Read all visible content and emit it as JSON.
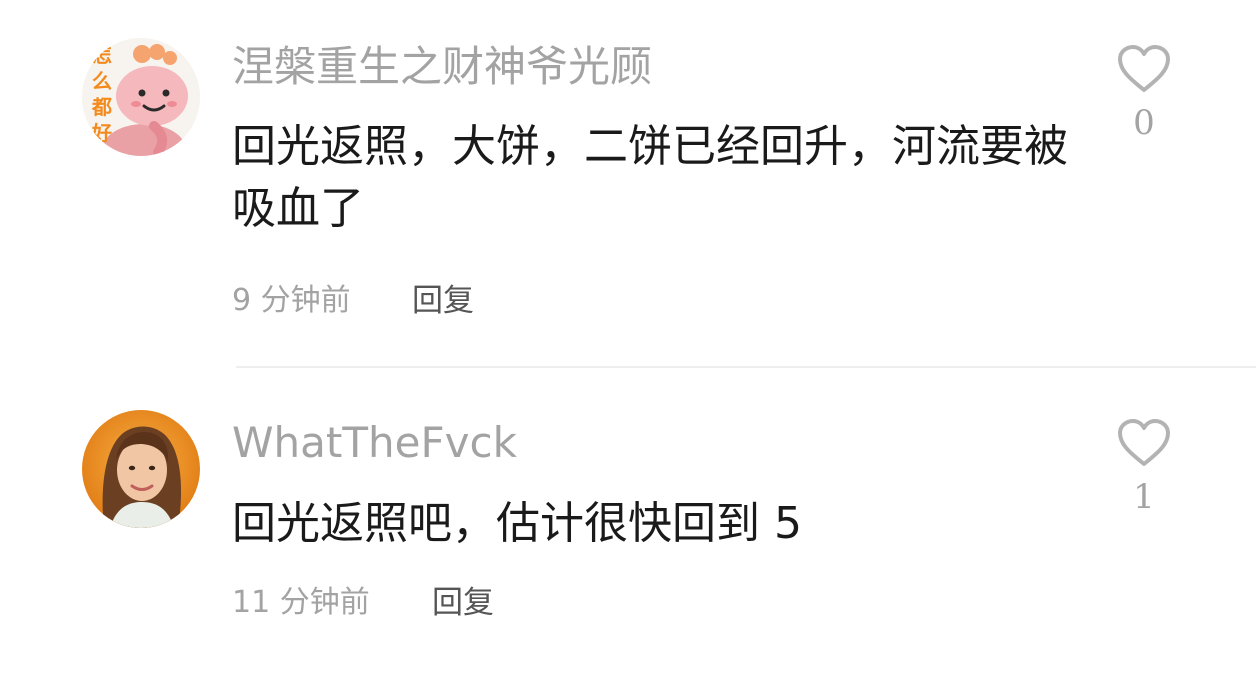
{
  "comments": [
    {
      "username": "涅槃重生之财神爷光顾",
      "avatar_icon": "pink-plush-doll-avatar",
      "avatar_text": "怎么都好",
      "text": "回光返照，大饼，二饼已经回升，河流要被吸血了",
      "time": "9 分钟前",
      "reply_label": "回复",
      "like_count": "0"
    },
    {
      "username": "WhatTheFvck",
      "avatar_icon": "woman-portrait-avatar",
      "text": "回光返照吧，估计很快回到 5",
      "time": "11 分钟前",
      "reply_label": "回复",
      "like_count": "1"
    }
  ],
  "colors": {
    "secondary_text": "#a3a3a3",
    "body_text": "#1a1a1a",
    "reply_text": "#555555",
    "heart_outline": "#b3b3b3",
    "divider": "#eeeeee"
  }
}
